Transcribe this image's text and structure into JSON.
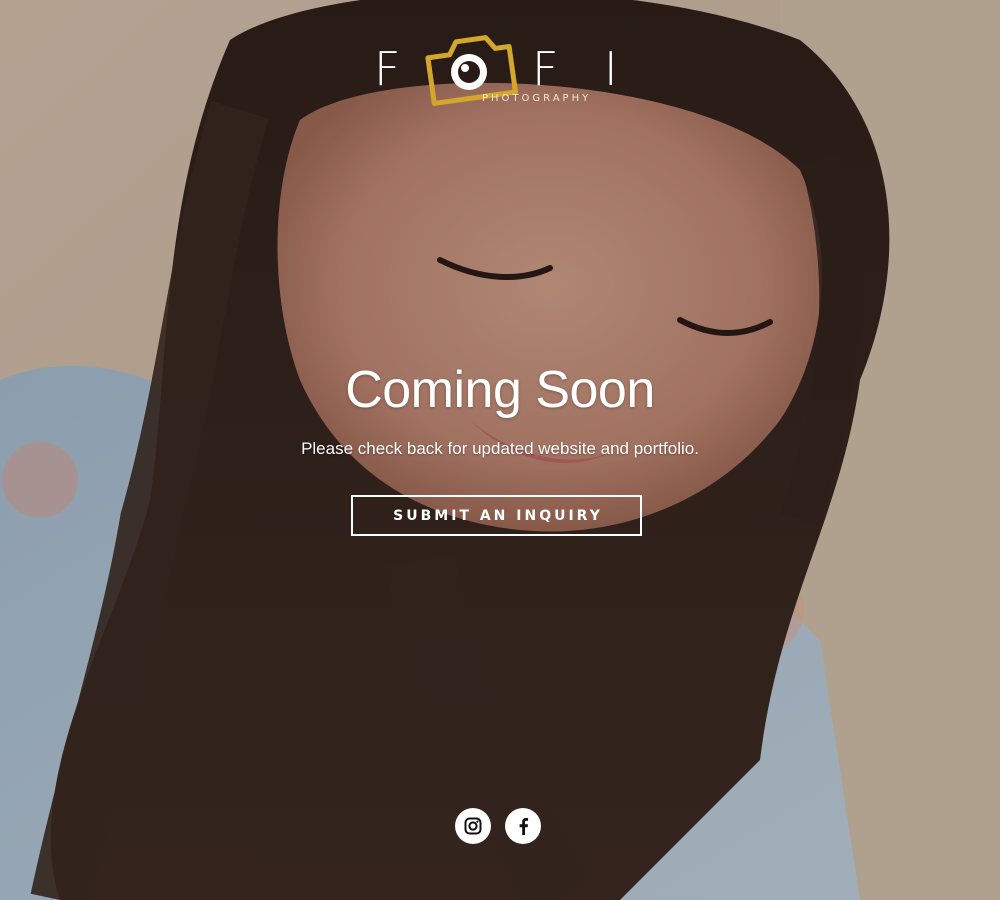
{
  "brand": {
    "letters": [
      "F",
      "F",
      "I"
    ],
    "subtitle": "PHOTOGRAPHY",
    "accent_color": "#d4a72c"
  },
  "hero": {
    "title": "Coming Soon",
    "subtitle": "Please check back for updated website and portfolio.",
    "cta_label": "SUBMIT AN INQUIRY"
  },
  "social": {
    "items": [
      {
        "icon": "instagram-icon"
      },
      {
        "icon": "facebook-icon"
      }
    ]
  }
}
